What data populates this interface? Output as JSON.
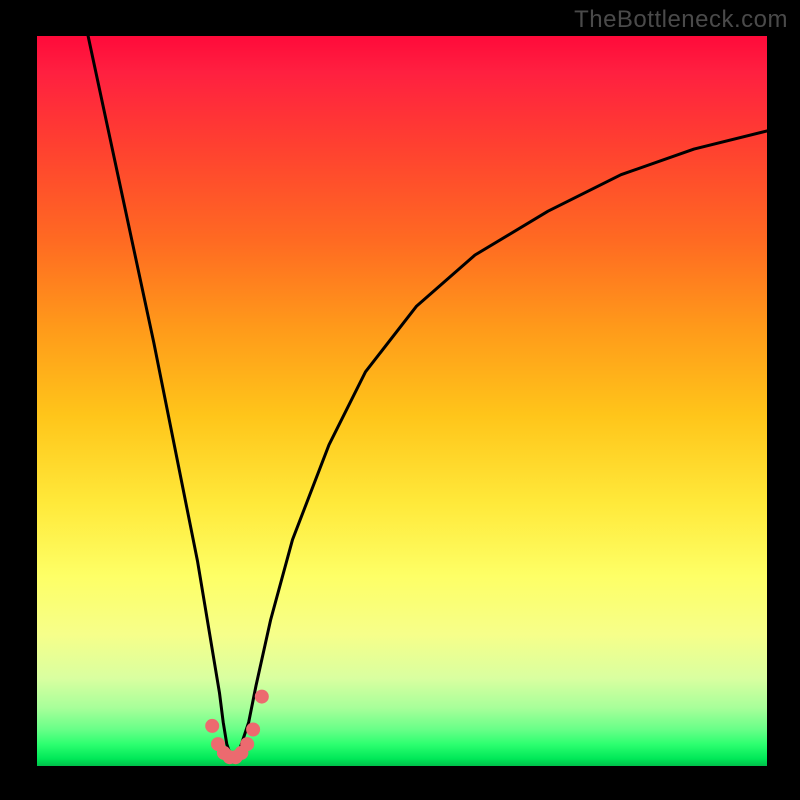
{
  "watermark": "TheBottleneck.com",
  "chart_data": {
    "type": "line",
    "title": "",
    "xlabel": "",
    "ylabel": "",
    "xlim": [
      0,
      100
    ],
    "ylim": [
      0,
      100
    ],
    "series": [
      {
        "name": "bottleneck-curve",
        "x": [
          7,
          10,
          13,
          16,
          18,
          20,
          22,
          23,
          24,
          25,
          25.5,
          26,
          26.5,
          27,
          27.5,
          28,
          29,
          30,
          32,
          35,
          40,
          45,
          52,
          60,
          70,
          80,
          90,
          100
        ],
        "y": [
          100,
          86,
          72,
          58,
          48,
          38,
          28,
          22,
          16,
          10,
          6,
          3,
          1.5,
          1,
          1.5,
          3,
          6,
          11,
          20,
          31,
          44,
          54,
          63,
          70,
          76,
          81,
          84.5,
          87
        ]
      }
    ],
    "markers": {
      "name": "highlight-dots",
      "x": [
        24.0,
        24.8,
        25.6,
        26.4,
        27.2,
        28.0,
        28.8,
        29.6,
        30.8
      ],
      "y": [
        5.5,
        3.0,
        1.8,
        1.2,
        1.2,
        1.8,
        3.0,
        5.0,
        9.5
      ]
    },
    "background_gradient": {
      "top": "#ff0a3a",
      "bottom": "#00c04a"
    }
  }
}
